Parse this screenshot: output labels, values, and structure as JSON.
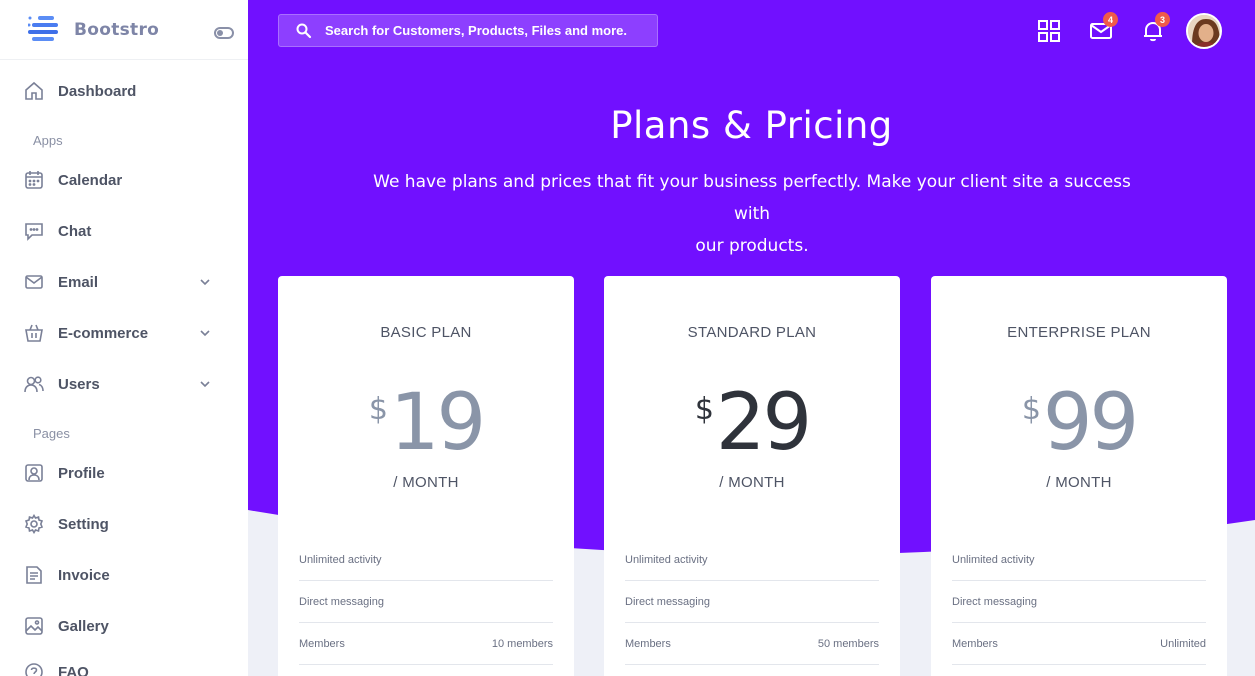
{
  "brand": {
    "name": "Bootstro"
  },
  "sidebar": {
    "items": [
      {
        "label": "Dashboard",
        "icon": "home-icon"
      },
      {
        "label": "Calendar",
        "icon": "calendar-icon"
      },
      {
        "label": "Chat",
        "icon": "chat-icon"
      },
      {
        "label": "Email",
        "icon": "mail-icon",
        "expandable": true
      },
      {
        "label": "E-commerce",
        "icon": "basket-icon",
        "expandable": true
      },
      {
        "label": "Users",
        "icon": "users-icon",
        "expandable": true
      },
      {
        "label": "Profile",
        "icon": "profile-icon"
      },
      {
        "label": "Setting",
        "icon": "gear-icon"
      },
      {
        "label": "Invoice",
        "icon": "invoice-icon"
      },
      {
        "label": "Gallery",
        "icon": "gallery-icon"
      },
      {
        "label": "FAQ",
        "icon": "faq-icon"
      }
    ],
    "sections": [
      "Apps",
      "Pages"
    ]
  },
  "header": {
    "search_placeholder": "Search for Customers, Products, Files and more.",
    "mail_count": "4",
    "notification_count": "3"
  },
  "hero": {
    "title": "Plans & Pricing",
    "subtitle_line1": "We have plans and prices that fit your business perfectly. Make your client site a success with",
    "subtitle_line2": "our products."
  },
  "plans": [
    {
      "name": "BASIC PLAN",
      "currency": "$",
      "price": "19",
      "period": "/ MONTH",
      "features": [
        {
          "label": "Unlimited activity",
          "value": ""
        },
        {
          "label": "Direct messaging",
          "value": ""
        },
        {
          "label": "Members",
          "value": "10 members"
        }
      ]
    },
    {
      "name": "STANDARD PLAN",
      "currency": "$",
      "price": "29",
      "period": "/ MONTH",
      "features": [
        {
          "label": "Unlimited activity",
          "value": ""
        },
        {
          "label": "Direct messaging",
          "value": ""
        },
        {
          "label": "Members",
          "value": "50 members"
        }
      ]
    },
    {
      "name": "ENTERPRISE PLAN",
      "currency": "$",
      "price": "99",
      "period": "/ MONTH",
      "features": [
        {
          "label": "Unlimited activity",
          "value": ""
        },
        {
          "label": "Direct messaging",
          "value": ""
        },
        {
          "label": "Members",
          "value": "Unlimited"
        }
      ]
    }
  ],
  "colors": {
    "primary": "#7110ff",
    "page_bg": "#eef0f7",
    "badge": "#f05a4a",
    "price_muted": "#8a95a8",
    "price_dark": "#2f333b"
  }
}
